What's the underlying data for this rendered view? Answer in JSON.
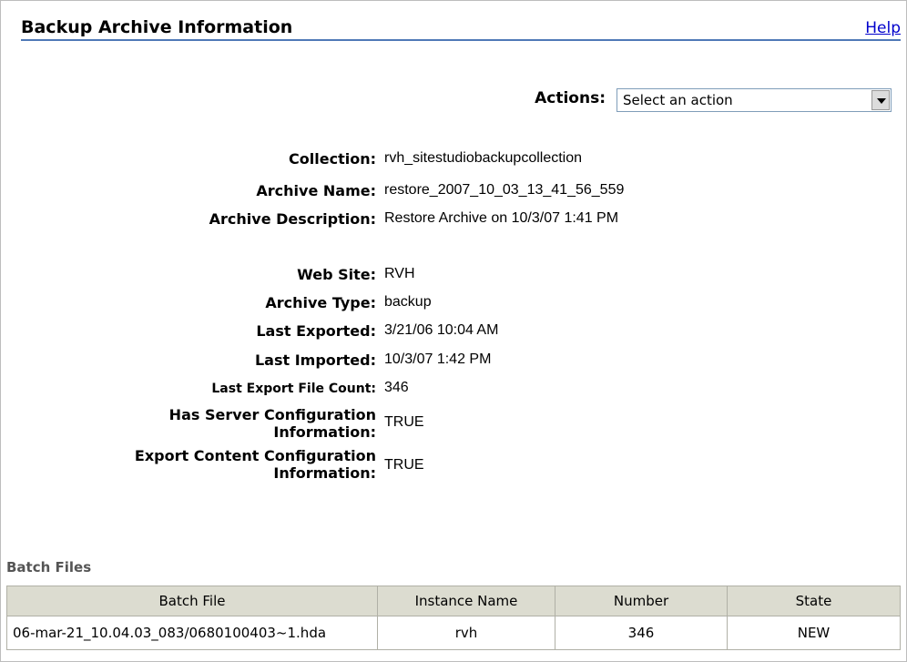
{
  "header": {
    "title": "Backup Archive Information",
    "help": "Help"
  },
  "actions": {
    "label": "Actions:",
    "selected": "Select an action"
  },
  "fields": [
    {
      "label": "Collection:",
      "value": "rvh_sitestudiobackupcollection"
    },
    {
      "label": "Archive Name:",
      "value": "restore_2007_10_03_13_41_56_559"
    },
    {
      "label": "Archive Description:",
      "value": "Restore Archive on 10/3/07 1:41 PM"
    },
    {
      "label": "Web Site:",
      "value": "RVH"
    },
    {
      "label": "Archive Type:",
      "value": "backup"
    },
    {
      "label": "Last Exported:",
      "value": "3/21/06 10:04 AM"
    },
    {
      "label": "Last Imported:",
      "value": "10/3/07 1:42 PM"
    },
    {
      "label": "Last Export File Count:",
      "value": "346"
    },
    {
      "label_line1": "Has Server Configuration",
      "label_line2": "Information:",
      "value": "TRUE"
    },
    {
      "label_line1": "Export Content Configuration",
      "label_line2": "Information:",
      "value": "TRUE"
    }
  ],
  "batch": {
    "title": "Batch Files",
    "columns": [
      "Batch File",
      "Instance Name",
      "Number",
      "State"
    ],
    "rows": [
      [
        "06-mar-21_10.04.03_083/0680100403~1.hda",
        "rvh",
        "346",
        "NEW"
      ]
    ]
  }
}
